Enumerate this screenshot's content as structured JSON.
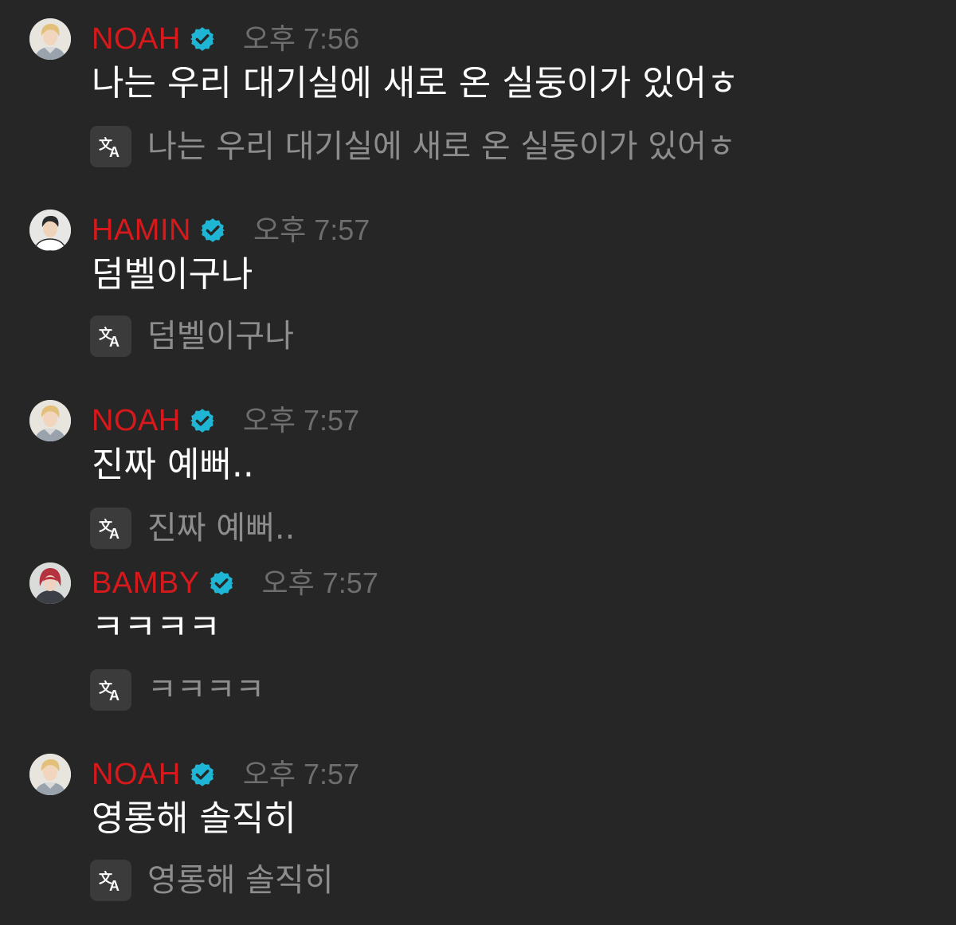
{
  "colors": {
    "background": "#262626",
    "author": "#d8191c",
    "verified_badge": "#1fb6d6",
    "timestamp": "#6e6e6e",
    "message_text": "#ffffff",
    "translation_text": "#8d8d8d",
    "translate_icon_bg": "#3b3b3b"
  },
  "icons": {
    "verified": "verified-badge-icon",
    "translate": "translate-icon"
  },
  "messages": [
    {
      "author": "NOAH",
      "avatar": "noah-avatar",
      "verified": true,
      "time": "오후 7:56",
      "text": "나는 우리 대기실에 새로 온 실둥이가 있어ㅎ",
      "translation": "나는 우리 대기실에 새로 온 실둥이가 있어ㅎ"
    },
    {
      "author": "HAMIN",
      "avatar": "hamin-avatar",
      "verified": true,
      "time": "오후 7:57",
      "text": "덤벨이구나",
      "translation": "덤벨이구나"
    },
    {
      "author": "NOAH",
      "avatar": "noah-avatar",
      "verified": true,
      "time": "오후 7:57",
      "text": "진짜 예뻐..",
      "translation": "진짜 예뻐.."
    },
    {
      "author": "BAMBY",
      "avatar": "bamby-avatar",
      "verified": true,
      "time": "오후 7:57",
      "text": "ㅋㅋㅋㅋ",
      "translation": "ㅋㅋㅋㅋ"
    },
    {
      "author": "NOAH",
      "avatar": "noah-avatar",
      "verified": true,
      "time": "오후 7:57",
      "text": "영롱해 솔직히",
      "translation": "영롱해 솔직히"
    }
  ]
}
